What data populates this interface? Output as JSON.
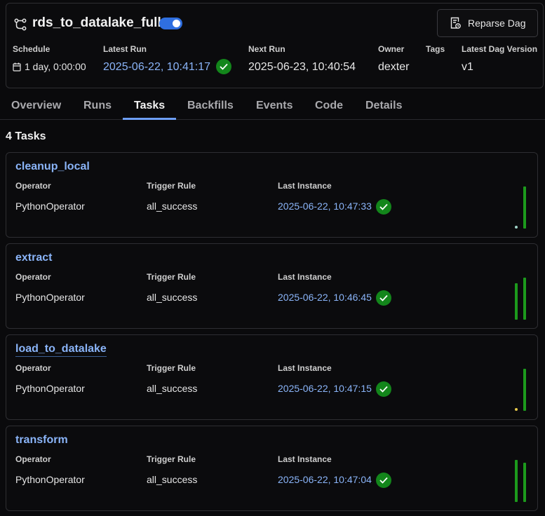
{
  "header": {
    "dag_id": "rds_to_datalake_full",
    "paused_toggle": "on",
    "reparse_label": "Reparse Dag",
    "meta": {
      "schedule_label": "Schedule",
      "schedule_value": "1 day, 0:00:00",
      "latest_run_label": "Latest Run",
      "latest_run_value": "2025-06-22, 10:41:17",
      "latest_run_state": "success",
      "next_run_label": "Next Run",
      "next_run_value": "2025-06-23, 10:40:54",
      "owner_label": "Owner",
      "owner_value": "dexter",
      "tags_label": "Tags",
      "version_label": "Latest Dag Version",
      "version_value": "v1"
    }
  },
  "tabs": [
    {
      "label": "Overview"
    },
    {
      "label": "Runs"
    },
    {
      "label": "Tasks",
      "active": true
    },
    {
      "label": "Backfills"
    },
    {
      "label": "Events"
    },
    {
      "label": "Code"
    },
    {
      "label": "Details"
    }
  ],
  "tasks_heading": "4 Tasks",
  "columns": {
    "operator": "Operator",
    "trigger_rule": "Trigger Rule",
    "last_instance": "Last Instance"
  },
  "tasks": [
    {
      "name": "cleanup_local",
      "operator": "PythonOperator",
      "trigger_rule": "all_success",
      "last_instance": "2025-06-22, 10:47:33",
      "state": "success"
    },
    {
      "name": "extract",
      "operator": "PythonOperator",
      "trigger_rule": "all_success",
      "last_instance": "2025-06-22, 10:46:45",
      "state": "success"
    },
    {
      "name": "load_to_datalake",
      "operator": "PythonOperator",
      "trigger_rule": "all_success",
      "last_instance": "2025-06-22, 10:47:15",
      "state": "success"
    },
    {
      "name": "transform",
      "operator": "PythonOperator",
      "trigger_rule": "all_success",
      "last_instance": "2025-06-22, 10:47:04",
      "state": "success"
    }
  ],
  "colors": {
    "success": "#13861b",
    "link": "#8ab4f8",
    "accent": "#2f6fe0",
    "tab_underline": "#6d9ef5",
    "queued_dot": "#e5c84a",
    "idle_dot": "#9fd3c7"
  }
}
